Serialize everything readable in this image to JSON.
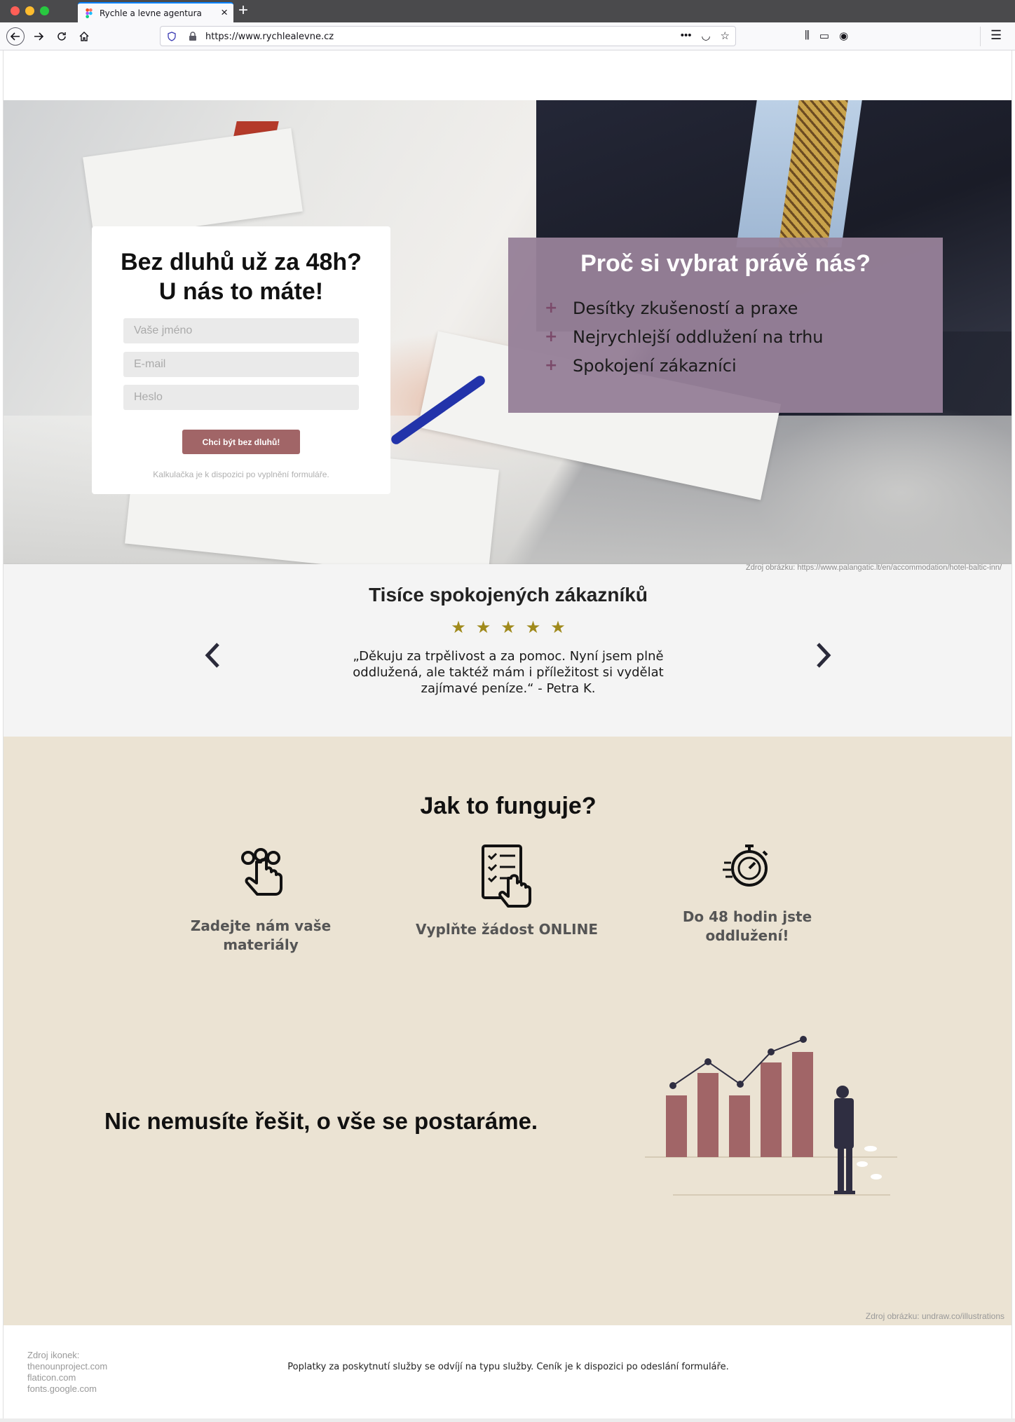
{
  "browser": {
    "tab_title": "Rychle a levne agentura",
    "url": "https://www.rychlealevne.cz"
  },
  "hero": {
    "form": {
      "title_line1": "Bez dluhů už za 48h?",
      "title_line2": "U nás to máte!",
      "name_placeholder": "Vaše jméno",
      "email_placeholder": "E-mail",
      "password_placeholder": "Heslo",
      "submit_label": "Chci být bez dluhů!",
      "note": "Kalkulačka je k dispozici po vyplnění formuláře."
    },
    "why": {
      "title": "Proč si vybrat právě nás?",
      "items": [
        "Desítky zkušeností a praxe",
        "Nejrychlejší oddlužení na trhu",
        "Spokojení zákazníci"
      ]
    },
    "image_credit": "Zdroj obrázku: https://www.palangatic.lt/en/accommodation/hotel-baltic-inn/"
  },
  "reviews": {
    "title": "Tisíce spokojených zákazníků",
    "rating": 5,
    "star_color": "#a08a1c",
    "quote": "„Děkuju za trpělivost a za pomoc. Nyní jsem plně oddlužená, ale taktéž mám i příležitost si vydělat zajímavé peníze.“ - Petra K."
  },
  "how": {
    "title": "Jak to funguje?",
    "steps": [
      {
        "icon": "touch-hand-icon",
        "label": "Zadejte nám vaše materiály"
      },
      {
        "icon": "checklist-hand-icon",
        "label": "Vyplňte žádost ONLINE"
      },
      {
        "icon": "stopwatch-icon",
        "label_line1": "Do 48 hodin jste",
        "label_line2": "oddlužení!"
      }
    ],
    "slogan": "Nic nemusíte řešit, o vše se postaráme.",
    "image_credit": "Zdroj obrázku: undraw.co/illustrations"
  },
  "footer": {
    "credits_title": "Zdroj ikonek:",
    "credits": [
      "thenounproject.com",
      "flaticon.com",
      "fonts.google.com"
    ],
    "text": "Poplatky za poskytnutí služby se odvíjí na typu služby. Ceník je k dispozici po odeslání formuláře."
  },
  "colors": {
    "accent_button": "#a16567",
    "why_box": "#968098",
    "section_bg": "#ebe3d3",
    "bar_color": "#a16567"
  }
}
